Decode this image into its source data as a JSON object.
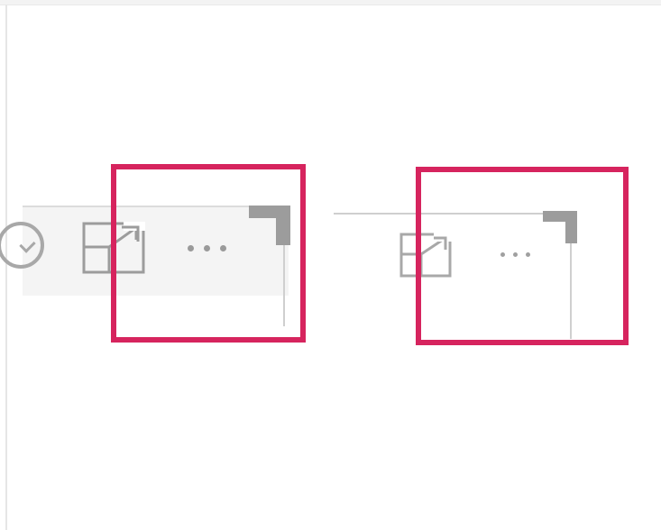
{
  "colors": {
    "highlight": "#d6245e",
    "icon_gray": "#9c9c9c",
    "header_bg": "#f4f4f4",
    "line": "#cfcfcf"
  },
  "left_variant": {
    "icons": [
      "partial-circle-icon",
      "focus-mode-icon",
      "more-options-icon",
      "corner-resize-handle-icon"
    ]
  },
  "right_variant": {
    "icons": [
      "focus-mode-icon",
      "more-options-icon",
      "corner-resize-handle-icon"
    ]
  }
}
